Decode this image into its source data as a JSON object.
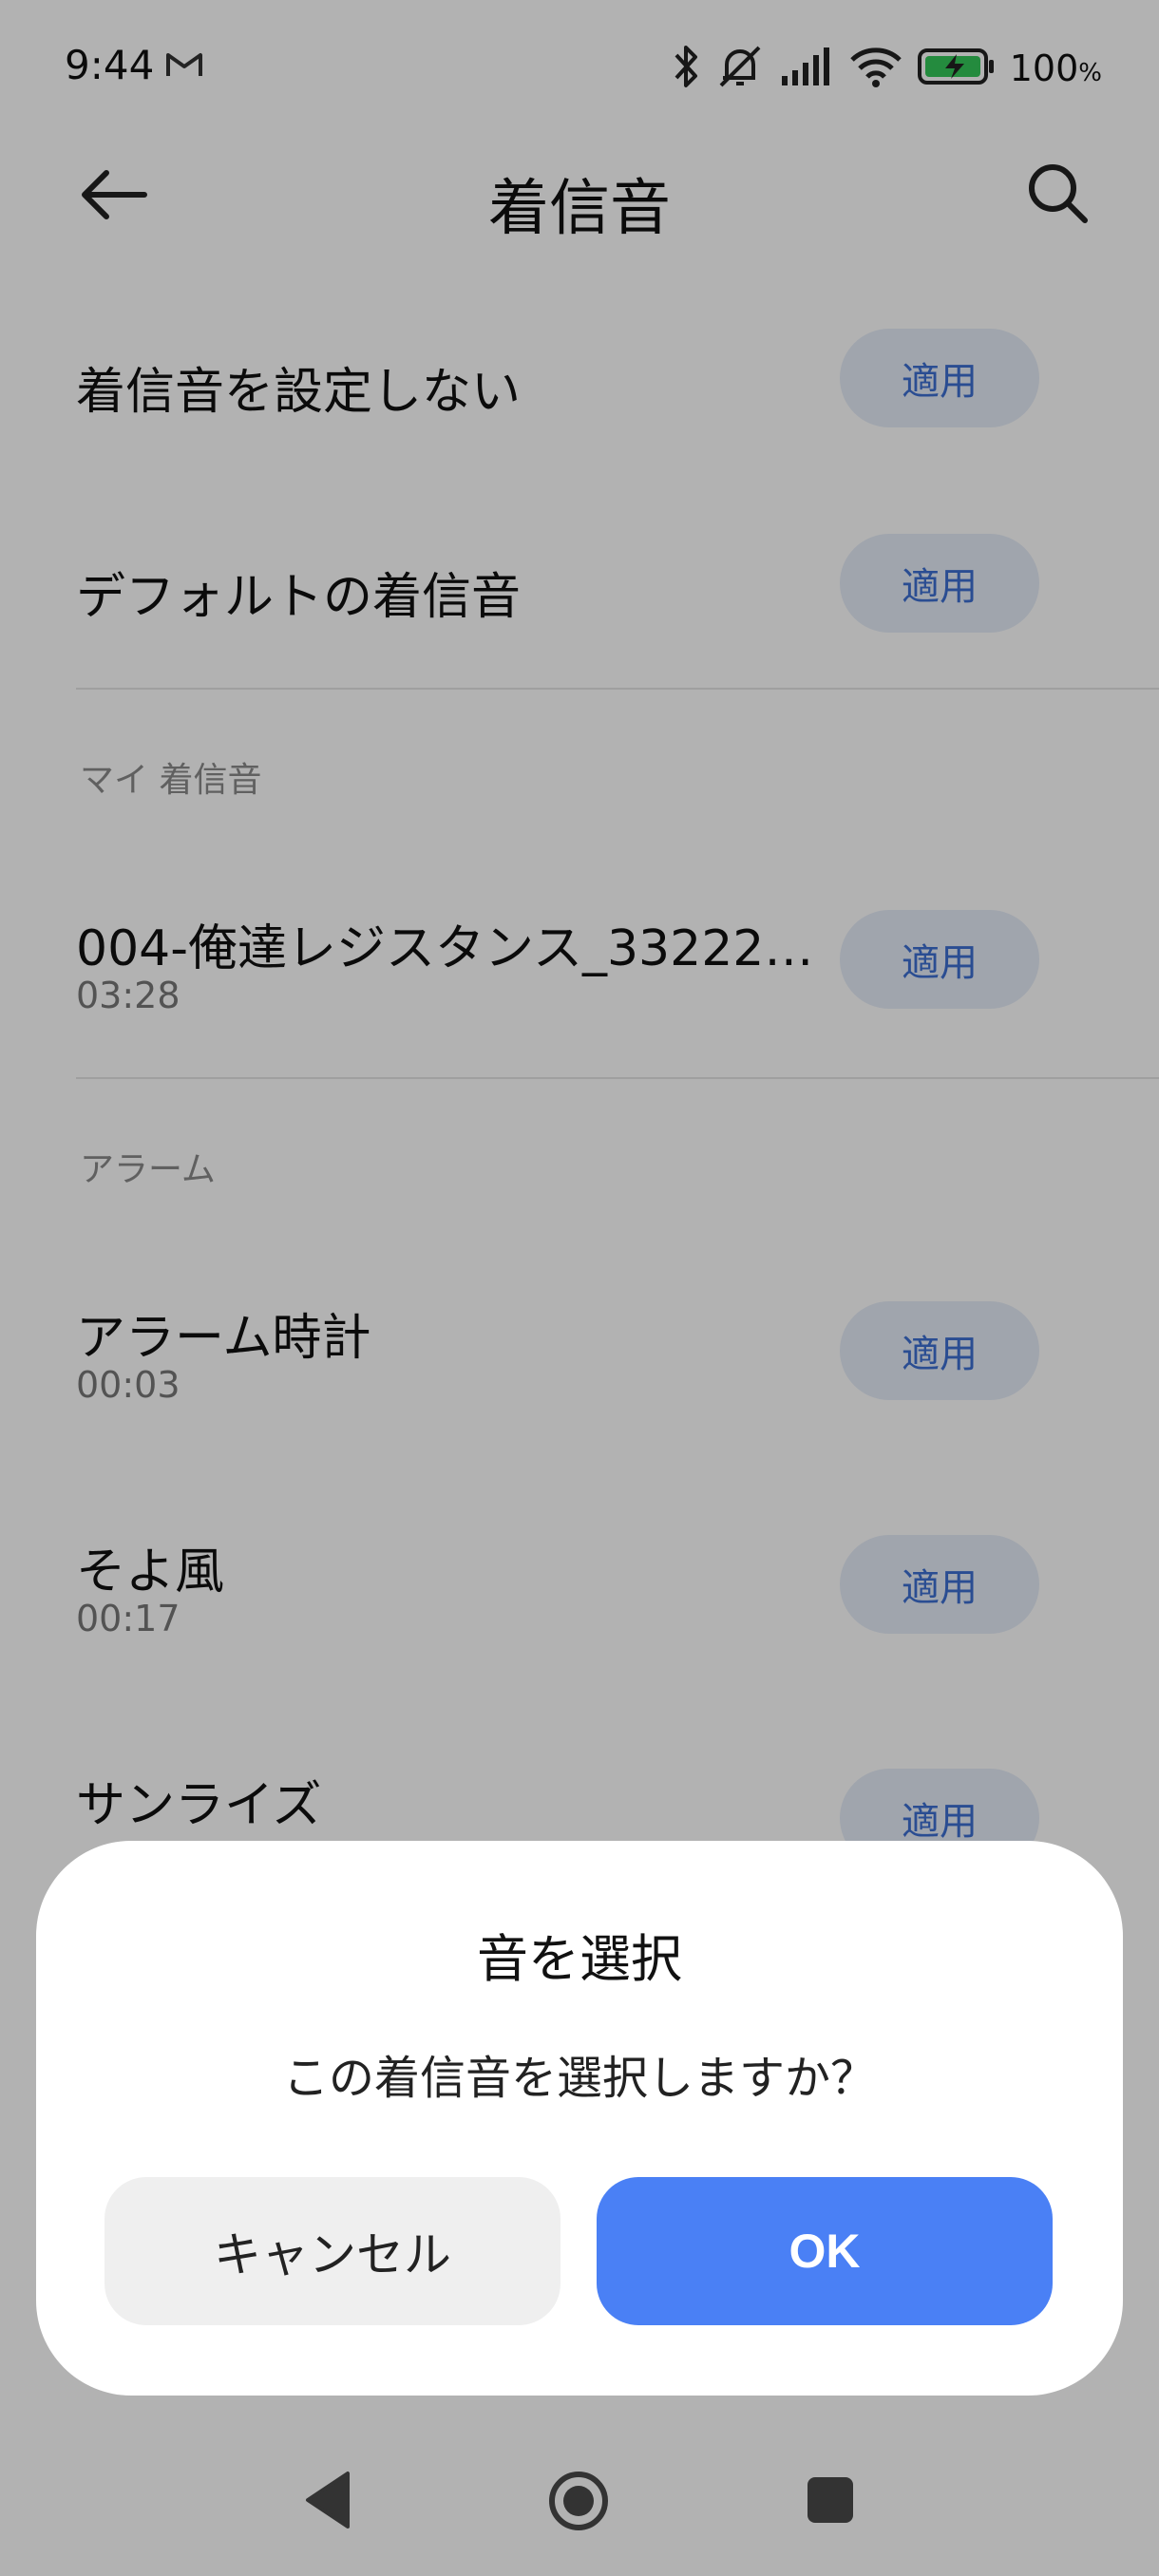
{
  "status_bar": {
    "time": "9:44",
    "battery_percent": "100",
    "battery_unit": "%",
    "icons": [
      "gmail-icon",
      "bluetooth-icon",
      "mute-icon",
      "signal-icon",
      "wifi-icon",
      "battery-charging-icon"
    ]
  },
  "header": {
    "title": "着信音",
    "icons": [
      "back-arrow-icon",
      "search-icon"
    ]
  },
  "list": {
    "apply_label": "適用",
    "top_items": [
      {
        "title": "着信音を設定しない"
      },
      {
        "title": "デフォルトの着信音"
      }
    ],
    "my_ringtones": {
      "header": "マイ 着信音",
      "items": [
        {
          "title": "004-俺達レジスタンス_3322249…",
          "duration": "03:28"
        }
      ]
    },
    "alarms": {
      "header": "アラーム",
      "items": [
        {
          "title": "アラーム時計",
          "duration": "00:03"
        },
        {
          "title": "そよ風",
          "duration": "00:17"
        },
        {
          "title": "サンライズ",
          "duration": ""
        }
      ]
    }
  },
  "dialog": {
    "title": "音を選択",
    "message": "この着信音を選択しますか？",
    "cancel_label": "キャンセル",
    "ok_label": "OK"
  },
  "colors": {
    "accent": "#4a80f5",
    "apply_text": "#3d6fd1",
    "apply_bg": "#e6edf8"
  }
}
